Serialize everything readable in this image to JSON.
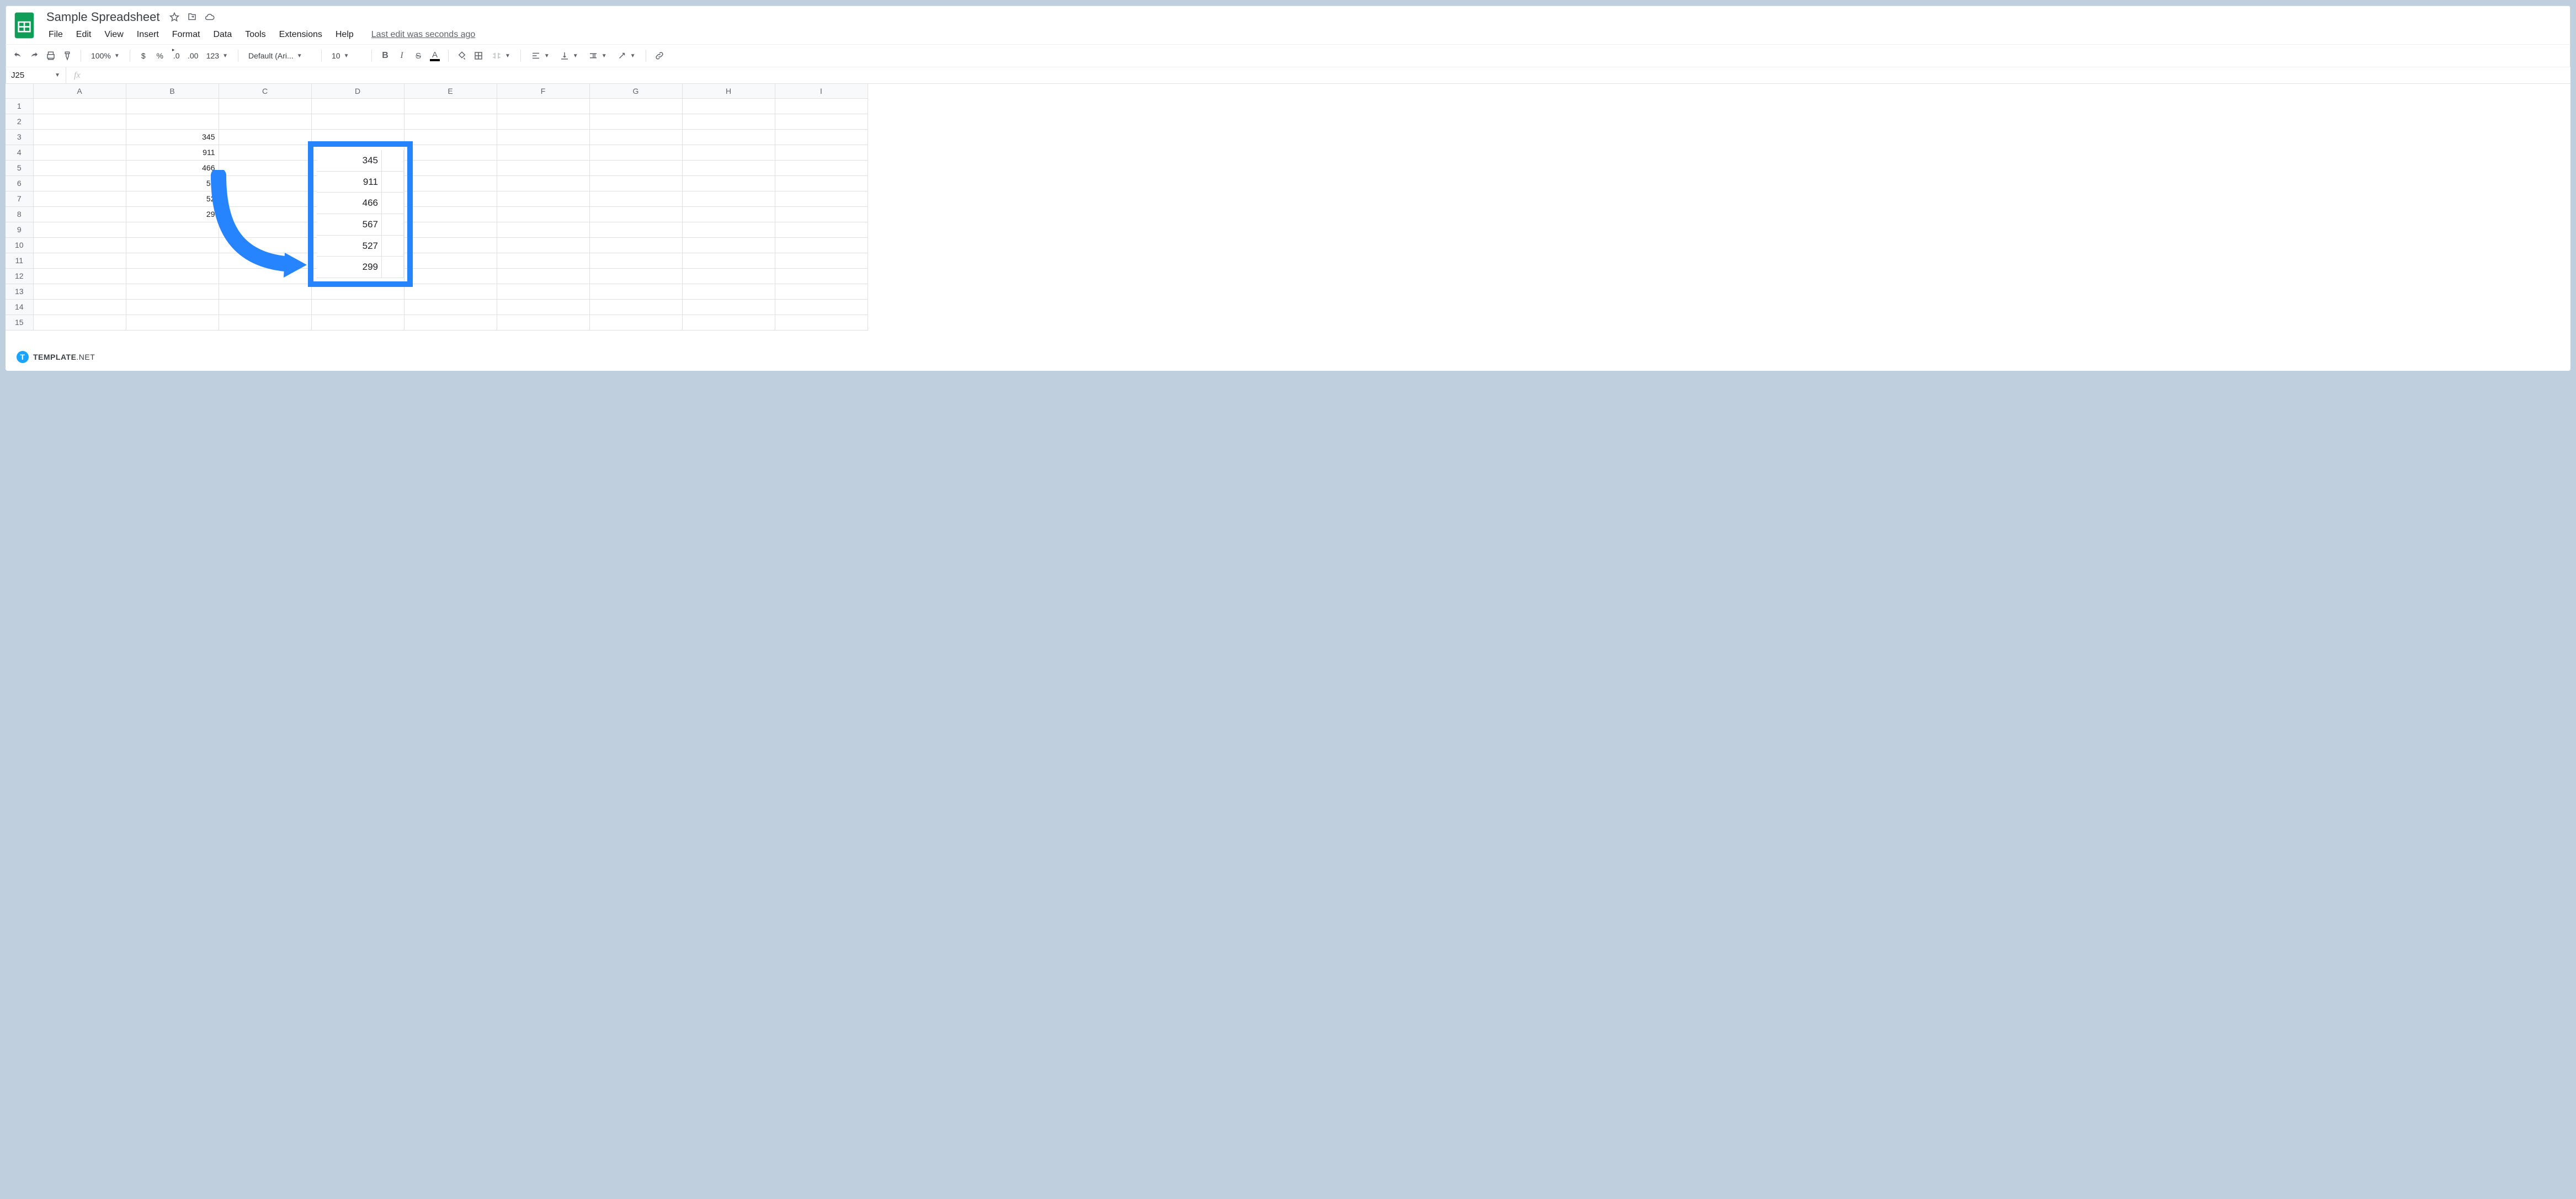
{
  "header": {
    "title": "Sample Spreadsheet",
    "last_edit": "Last edit was seconds ago"
  },
  "menus": [
    "File",
    "Edit",
    "View",
    "Insert",
    "Format",
    "Data",
    "Tools",
    "Extensions",
    "Help"
  ],
  "toolbar": {
    "zoom": "100%",
    "currency": "$",
    "percent": "%",
    "dec_dec": ".0",
    "inc_dec": ".00",
    "more_fmt": "123",
    "font": "Default (Ari...",
    "font_size": "10"
  },
  "formula_bar": {
    "name_box": "J25",
    "fx": "fx",
    "formula": ""
  },
  "columns": [
    "A",
    "B",
    "C",
    "D",
    "E",
    "F",
    "G",
    "H",
    "I"
  ],
  "row_numbers": [
    1,
    2,
    3,
    4,
    5,
    6,
    7,
    8,
    9,
    10,
    11,
    12,
    13,
    14,
    15
  ],
  "cells": {
    "B3": "345",
    "B4": "911",
    "B5": "466",
    "B6": "56",
    "B7": "52",
    "B8": "29"
  },
  "annotation": {
    "overlay_values": [
      "345",
      "911",
      "466",
      "567",
      "527",
      "299"
    ],
    "color": "#2684ff"
  },
  "watermark": {
    "badge": "T",
    "brand": "TEMPLATE",
    "suffix": ".NET"
  }
}
